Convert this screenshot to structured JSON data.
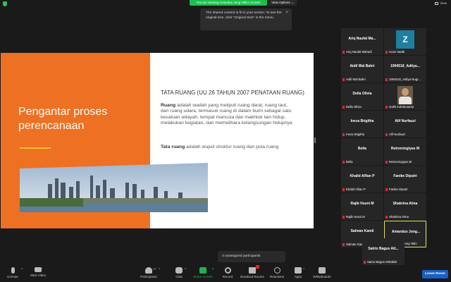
{
  "top": {
    "viewing_banner": "You are viewing Amandus Jong Tallo's screen",
    "view_options": "View Options",
    "view_options_caret": "⌄",
    "view": "View"
  },
  "tooltip": {
    "text": "The shared content is fit to your screen. To see the original size, click \"Original Size\" in the menu.",
    "close": "×"
  },
  "slide": {
    "title": "Pengantar proses perencanaan",
    "heading": "TATA RUANG (UU 26 TAHUN 2007 PENATAAN RUANG)",
    "p1_bold": "Ruang",
    "p1_rest": " adalah wadah yang meliputi ruang darat, ruang laut, dan ruang udara, termasuk ruang di dalam bumi sebagai satu kesatuan wilayah, tempat manusia dan makhluk lain hidup, melakukan kegiatan, dan memelihara kelangsungan hidupnya",
    "p2_bold": "Tata ruang",
    "p2_rest": " adalah wujud struktur ruang dan pola ruang"
  },
  "participants": [
    {
      "name": "Ariq Naufal Ma...",
      "label": "Ariq Naufal Mahadi"
    },
    {
      "name": "",
      "label": "zoom kaaliii",
      "avatar_letter": "Z"
    },
    {
      "name": "Aidil Wal Bahri",
      "label": "Aidil Wal Bahri"
    },
    {
      "name": "1904518_Aditya...",
      "label": "1904518_Aditya Nugr..."
    },
    {
      "name": "Della Olivia",
      "label": "Della Olivia"
    },
    {
      "name": "",
      "label": "Galih Indrahutama",
      "video": true
    },
    {
      "name": "Ineza Brigitha",
      "label": "Ineza Brigitha"
    },
    {
      "name": "Alif Nurfauzi",
      "label": "Alif Nurfauzi"
    },
    {
      "name": "Bella",
      "label": "Bella"
    },
    {
      "name": "Retnoningtyas M",
      "label": "Retnoningtyas M"
    },
    {
      "name": "Khalid Alfian P",
      "label": "Khalid Alfian P"
    },
    {
      "name": "Fanike Diputri",
      "label": "Fanike Diputri"
    },
    {
      "name": "Rajib Husni M",
      "label": "Rajib Husni M"
    },
    {
      "name": "Shabrina Alma",
      "label": "Shabrina Alma"
    },
    {
      "name": "Salman Kamil",
      "label": "Salman Kamil"
    },
    {
      "name": "Amandus Jong...",
      "label": "Amandus Jong Tallo",
      "active": true
    },
    {
      "name": "Satrio Bagus Att...",
      "label": "Satrio Bagus Atthallah"
    }
  ],
  "unassigned": "3 unassigned participants",
  "toolbar": {
    "unmute": "Unmute",
    "start_video": "Start Video",
    "participants": "Participants",
    "participants_count": "17",
    "chat": "Chat",
    "share_screen": "Share Screen",
    "record": "Record",
    "breakout_rooms": "Breakout Rooms",
    "reactions": "Reactions",
    "apps": "Apps",
    "whiteboards": "Whiteboards",
    "leave": "Leave Room",
    "caret": "^"
  },
  "colors": {
    "orange": "#ee7023",
    "share_green": "#22b14c",
    "leave_blue": "#1a5fc4",
    "active_border": "#e6e85a"
  }
}
